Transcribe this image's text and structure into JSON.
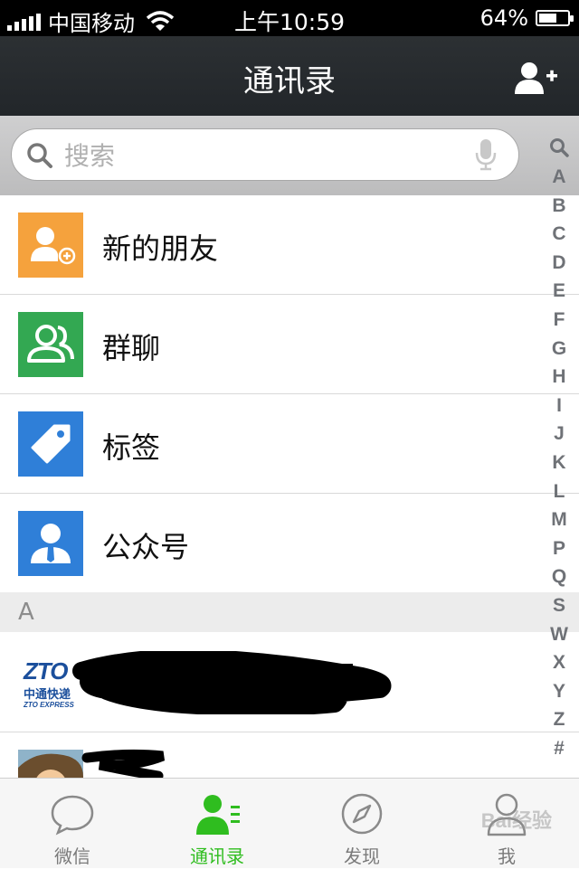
{
  "status_bar": {
    "carrier": "中国移动",
    "time": "上午10:59",
    "battery": "64%",
    "battery_level": 0.64
  },
  "nav": {
    "title": "通讯录"
  },
  "search": {
    "placeholder": "搜索"
  },
  "index_letters": [
    "A",
    "B",
    "C",
    "D",
    "E",
    "F",
    "G",
    "H",
    "I",
    "J",
    "K",
    "L",
    "M",
    "P",
    "Q",
    "S",
    "W",
    "X",
    "Y",
    "Z",
    "#"
  ],
  "entries": [
    {
      "label": "新的朋友",
      "color": "#f5a23d",
      "icon": "add-friend-icon"
    },
    {
      "label": "群聊",
      "color": "#33a852",
      "icon": "group-chat-icon"
    },
    {
      "label": "标签",
      "color": "#2f7fd8",
      "icon": "tag-icon"
    },
    {
      "label": "公众号",
      "color": "#2f7fd8",
      "icon": "official-account-icon"
    }
  ],
  "section": {
    "letter": "A"
  },
  "contacts": [
    {
      "avatar_text": "中通快递",
      "avatar_caption": "ZTO EXPRESS",
      "avatar_logo": "ZTO"
    }
  ],
  "tabs": [
    {
      "label": "微信",
      "icon": "chat-bubble-icon",
      "active": false
    },
    {
      "label": "通讯录",
      "icon": "contacts-icon",
      "active": true
    },
    {
      "label": "发现",
      "icon": "compass-icon",
      "active": false
    },
    {
      "label": "我",
      "icon": "profile-icon",
      "active": false
    }
  ],
  "watermark": "Bai经验",
  "colors": {
    "active_tab": "#2fbd1f",
    "nav_bg": "#272b2e"
  }
}
